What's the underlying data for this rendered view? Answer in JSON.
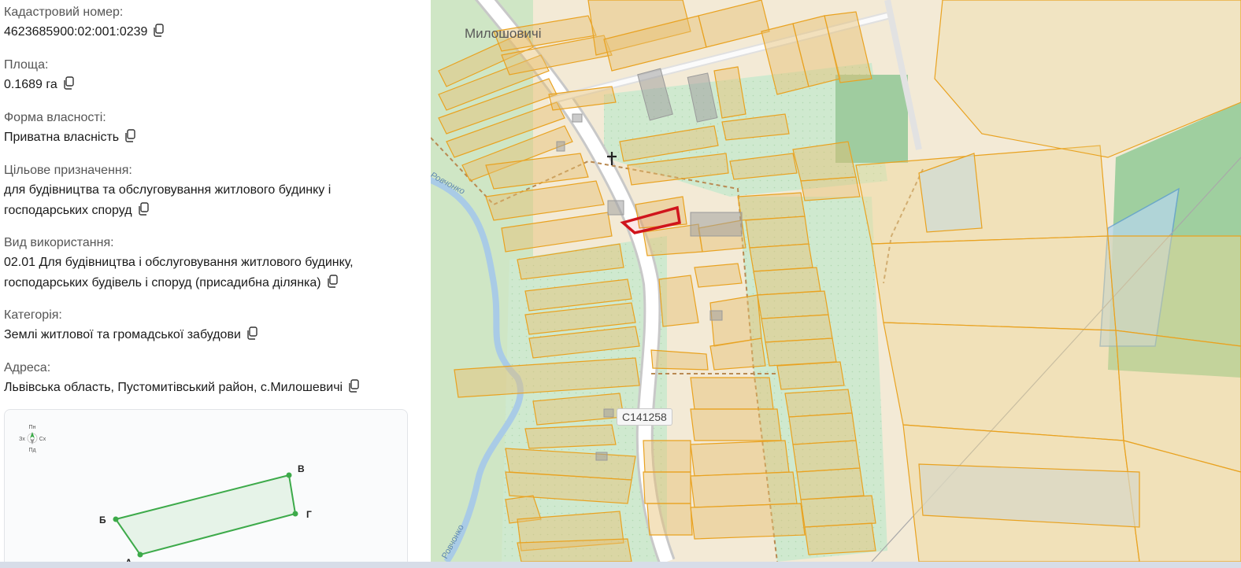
{
  "info_panel": {
    "fields": [
      {
        "label": "Кадастровий номер:",
        "value": "4623685900:02:001:0239"
      },
      {
        "label": "Площа:",
        "value": "0.1689 га"
      },
      {
        "label": "Форма власності:",
        "value": "Приватна власність"
      },
      {
        "label": "Цільове призначення:",
        "value_line1": "для будівництва та обслуговування житлового будинку і",
        "value_line2": "господарських споруд"
      },
      {
        "label": "Вид використання:",
        "value_line1": "02.01 Для будівництва і обслуговування житлового будинку,",
        "value_line2": "господарських будівель і споруд (присадибна ділянка)"
      },
      {
        "label": "Категорія:",
        "value": "Землі житлової та громадської забудови"
      },
      {
        "label": "Адреса:",
        "value": "Львівська область, Пустомитівський район, с.Милошевичі"
      }
    ]
  },
  "plan": {
    "compass": {
      "north": "Пн",
      "south": "Пд",
      "west": "Зх",
      "east": "Сх"
    },
    "vertices": {
      "a": "А",
      "b": "Б",
      "v": "В",
      "g": "Г"
    },
    "parcel_color": "#3daa4a"
  },
  "map": {
    "village_label": "Милошовичі",
    "road_label": "C141258",
    "river_label_1": "Ровчонко",
    "river_label_2": "Ровчонко",
    "highlight_color": "#d0141c",
    "parcel_outline_color": "#e9a220"
  }
}
